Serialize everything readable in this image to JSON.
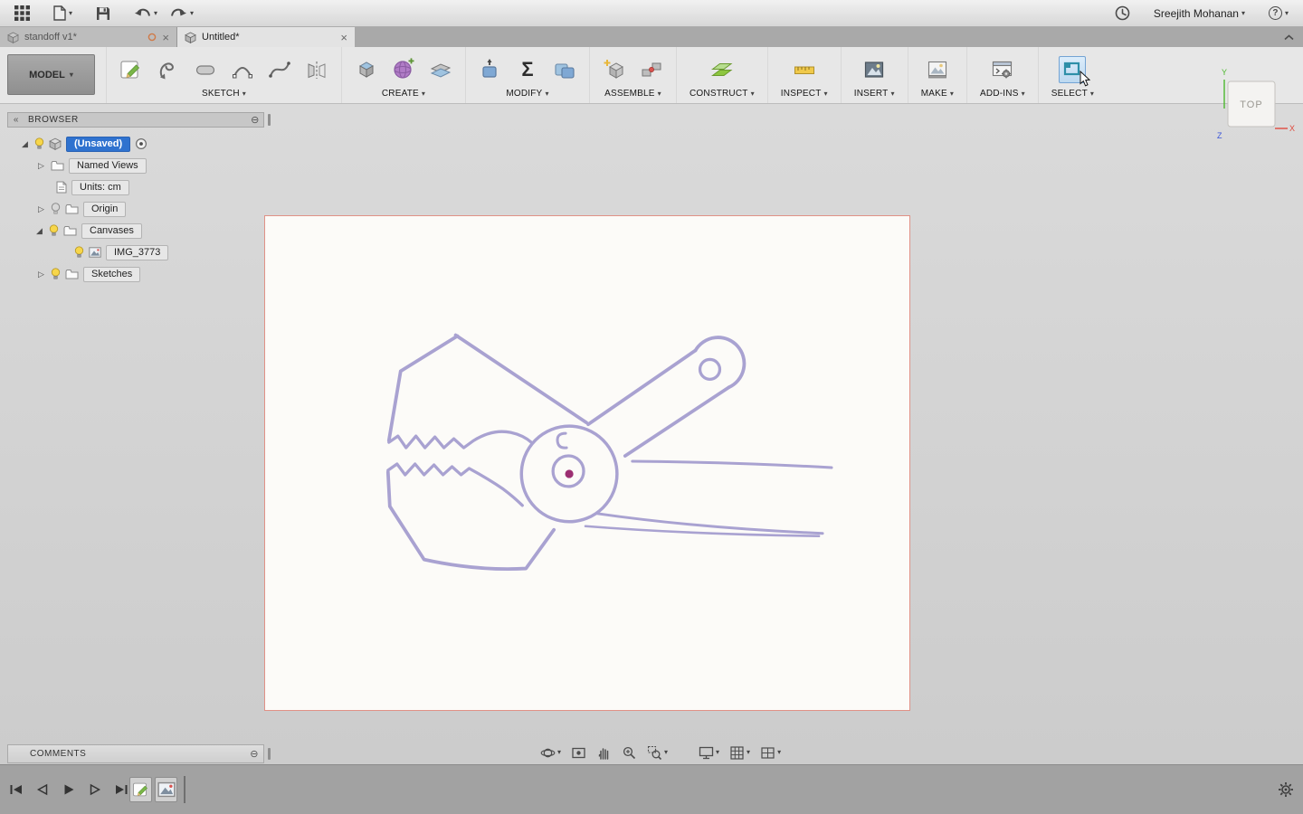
{
  "topbar": {
    "user_menu": "Sreejith Mohanan"
  },
  "tabs": [
    {
      "label": "standoff v1*"
    },
    {
      "label": "Untitled*"
    }
  ],
  "toolbar": {
    "workspace_label": "MODEL",
    "groups": [
      {
        "label": "SKETCH"
      },
      {
        "label": "CREATE"
      },
      {
        "label": "MODIFY"
      },
      {
        "label": "ASSEMBLE"
      },
      {
        "label": "CONSTRUCT"
      },
      {
        "label": "INSPECT"
      },
      {
        "label": "INSERT"
      },
      {
        "label": "MAKE"
      },
      {
        "label": "ADD-INS"
      },
      {
        "label": "SELECT"
      }
    ]
  },
  "browser": {
    "title": "BROWSER",
    "items": [
      {
        "label": "(Unsaved)",
        "selected": true
      },
      {
        "label": "Named Views"
      },
      {
        "label": "Units: cm"
      },
      {
        "label": "Origin"
      },
      {
        "label": "Canvases"
      },
      {
        "label": "IMG_3773"
      },
      {
        "label": "Sketches"
      }
    ]
  },
  "viewcube": {
    "face": "TOP",
    "axis_x": "X",
    "axis_y": "Y",
    "axis_z": "Z"
  },
  "comments": {
    "title": "COMMENTS"
  },
  "icons": {
    "caret_down": "▾",
    "close": "×",
    "collapse_left": "«",
    "circle_minus": "⊖",
    "help": "?",
    "sigma": "Σ",
    "expander_open": "◢",
    "expander_closed": "▷"
  },
  "colors": {
    "selection_blue": "#2f72cf",
    "canvas_border": "#e09186",
    "sketch_stroke": "#a29bce",
    "origin_dot": "#9c2f72",
    "axis_x_red": "#e04b3f",
    "axis_y_green": "#4db82e",
    "axis_z_blue": "#3a55d9",
    "select_highlight": "#bcd8f0"
  }
}
